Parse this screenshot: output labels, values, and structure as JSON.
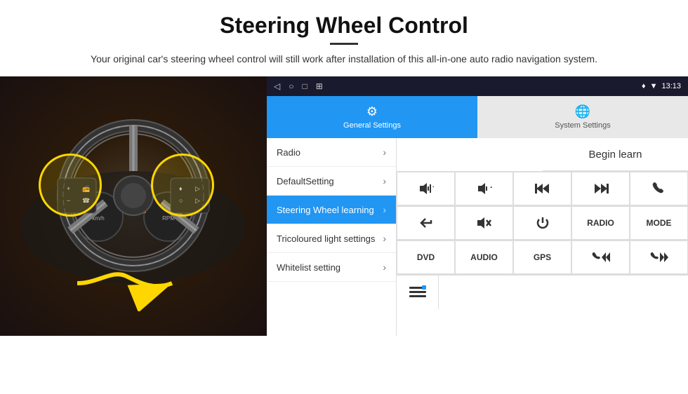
{
  "header": {
    "title": "Steering Wheel Control",
    "subtitle": "Your original car's steering wheel control will still work after installation of this all-in-one auto radio navigation system."
  },
  "statusBar": {
    "navIcons": [
      "◁",
      "○",
      "□",
      "⊞"
    ],
    "rightIcons": "♦ ▼",
    "time": "13:13"
  },
  "tabs": [
    {
      "id": "general",
      "icon": "⚙",
      "label": "General Settings",
      "active": true
    },
    {
      "id": "system",
      "icon": "🌐",
      "label": "System Settings",
      "active": false
    }
  ],
  "menuItems": [
    {
      "id": "radio",
      "label": "Radio",
      "active": false
    },
    {
      "id": "defaultsetting",
      "label": "DefaultSetting",
      "active": false
    },
    {
      "id": "steeringwheel",
      "label": "Steering Wheel learning",
      "active": true
    },
    {
      "id": "tricoloured",
      "label": "Tricoloured light settings",
      "active": false
    },
    {
      "id": "whitelist",
      "label": "Whitelist setting",
      "active": false
    }
  ],
  "controlPanel": {
    "beginLearn": "Begin learn",
    "row1Buttons": [
      {
        "label": "🔊+",
        "type": "icon"
      },
      {
        "label": "🔊−",
        "type": "icon"
      },
      {
        "label": "⏮",
        "type": "icon"
      },
      {
        "label": "⏭",
        "type": "icon"
      },
      {
        "label": "📞",
        "type": "icon"
      }
    ],
    "row2Buttons": [
      {
        "label": "↩",
        "type": "icon"
      },
      {
        "label": "🔇",
        "type": "icon"
      },
      {
        "label": "⏻",
        "type": "icon"
      },
      {
        "label": "RADIO",
        "type": "text"
      },
      {
        "label": "MODE",
        "type": "text"
      }
    ],
    "row3Buttons": [
      {
        "label": "DVD",
        "type": "text"
      },
      {
        "label": "AUDIO",
        "type": "text"
      },
      {
        "label": "GPS",
        "type": "text"
      },
      {
        "label": "📞⏮",
        "type": "icon"
      },
      {
        "label": "📞⏭",
        "type": "icon"
      }
    ],
    "whitelistIcon": "≡"
  }
}
